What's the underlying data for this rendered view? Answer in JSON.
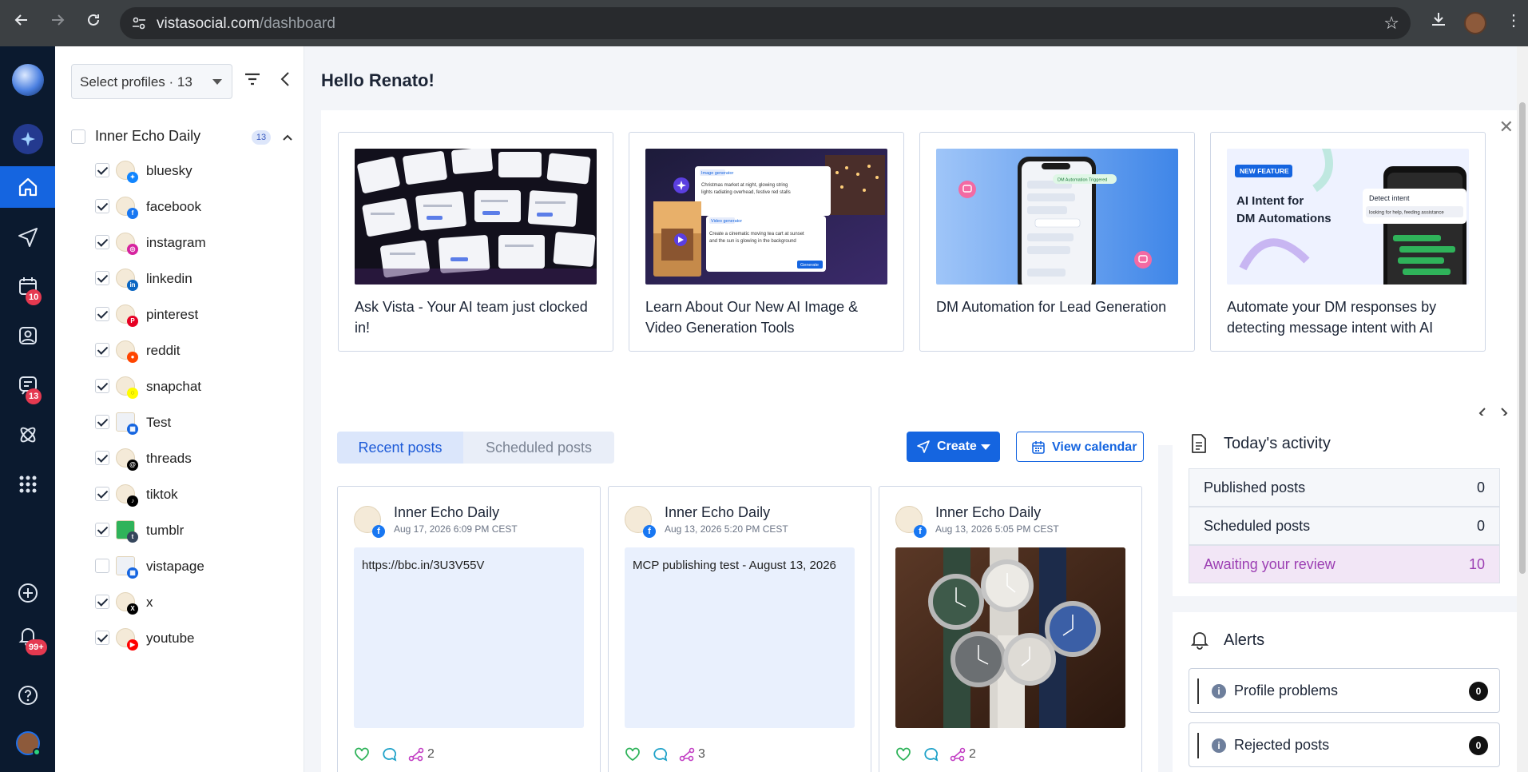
{
  "browser": {
    "url_domain": "vistasocial.com",
    "url_path": "/dashboard"
  },
  "rail": {
    "calendar_badge": "10",
    "inbox_badge": "13",
    "notifications_badge": "99+"
  },
  "sidebar": {
    "select_label": "Select profiles · 13",
    "group": {
      "name": "Inner Echo Daily",
      "count": "13"
    },
    "profiles": [
      {
        "name": "bluesky",
        "checked": true,
        "net": "bluesky",
        "color": "#1185fe"
      },
      {
        "name": "facebook",
        "checked": true,
        "net": "facebook",
        "color": "#1877f2"
      },
      {
        "name": "instagram",
        "checked": true,
        "net": "instagram",
        "color": "#d6249f"
      },
      {
        "name": "linkedin",
        "checked": true,
        "net": "linkedin",
        "color": "#0a66c2"
      },
      {
        "name": "pinterest",
        "checked": true,
        "net": "pinterest",
        "color": "#e60023"
      },
      {
        "name": "reddit",
        "checked": true,
        "net": "reddit",
        "color": "#ff4500"
      },
      {
        "name": "snapchat",
        "checked": true,
        "net": "snapchat",
        "color": "#fffc00"
      },
      {
        "name": "Test",
        "checked": true,
        "net": "vistapage",
        "color": "#1565e0"
      },
      {
        "name": "threads",
        "checked": true,
        "net": "threads",
        "color": "#000000"
      },
      {
        "name": "tiktok",
        "checked": true,
        "net": "tiktok",
        "color": "#000000"
      },
      {
        "name": "tumblr",
        "checked": true,
        "net": "tumblr",
        "color": "#35465c"
      },
      {
        "name": "vistapage",
        "checked": false,
        "net": "vistapage",
        "color": "#1565e0"
      },
      {
        "name": "x",
        "checked": true,
        "net": "x",
        "color": "#000000"
      },
      {
        "name": "youtube",
        "checked": true,
        "net": "youtube",
        "color": "#ff0000"
      }
    ]
  },
  "main": {
    "greeting": "Hello Renato!",
    "promo_cards": [
      {
        "title": "Ask Vista - Your AI team just clocked in!"
      },
      {
        "title": "Learn About Our New AI Image & Video Generation Tools"
      },
      {
        "title": "DM Automation for Lead Generation"
      },
      {
        "title": "Automate your DM responses by detecting message intent with AI"
      }
    ],
    "promo_images": {
      "dm_badge": "DM Automation Triggered",
      "new_feature": "NEW FEATURE",
      "intent_line1": "AI Intent for",
      "intent_line2": "DM Automations",
      "detect_intent": "Detect intent",
      "detect_sub": "looking for help, feeding assistance",
      "image_gen_line1": "Christmas market at night, glowing string",
      "image_gen_line2": "lights radiating overhead, festive red stalls",
      "video_gen_line1": "Create a cinematic moving tea cart at sunset",
      "video_gen_line2": "and the sun is glowing in the background",
      "gen_btn": "Generate",
      "tab_image": "Image generator",
      "tab_video": "Video generator"
    },
    "tabs": {
      "recent": "Recent posts",
      "scheduled": "Scheduled posts"
    },
    "create_label": "Create",
    "calendar_label": "View calendar",
    "posts": [
      {
        "author": "Inner Echo Daily",
        "date": "Aug 17, 2026 6:09 PM CEST",
        "text": "https://bbc.in/3U3V55V",
        "shares": "2"
      },
      {
        "author": "Inner Echo Daily",
        "date": "Aug 13, 2026 5:20 PM CEST",
        "text": "MCP publishing test - August 13, 2026",
        "shares": "3"
      },
      {
        "author": "Inner Echo Daily",
        "date": "Aug 13, 2026 5:05 PM CEST",
        "text": "",
        "shares": "2"
      }
    ],
    "activity": {
      "title": "Today's activity",
      "rows": [
        {
          "label": "Published posts",
          "value": "0"
        },
        {
          "label": "Scheduled posts",
          "value": "0"
        },
        {
          "label": "Awaiting your review",
          "value": "10"
        }
      ]
    },
    "alerts": {
      "title": "Alerts",
      "rows": [
        {
          "label": "Profile problems",
          "value": "0"
        },
        {
          "label": "Rejected posts",
          "value": "0"
        }
      ]
    }
  }
}
